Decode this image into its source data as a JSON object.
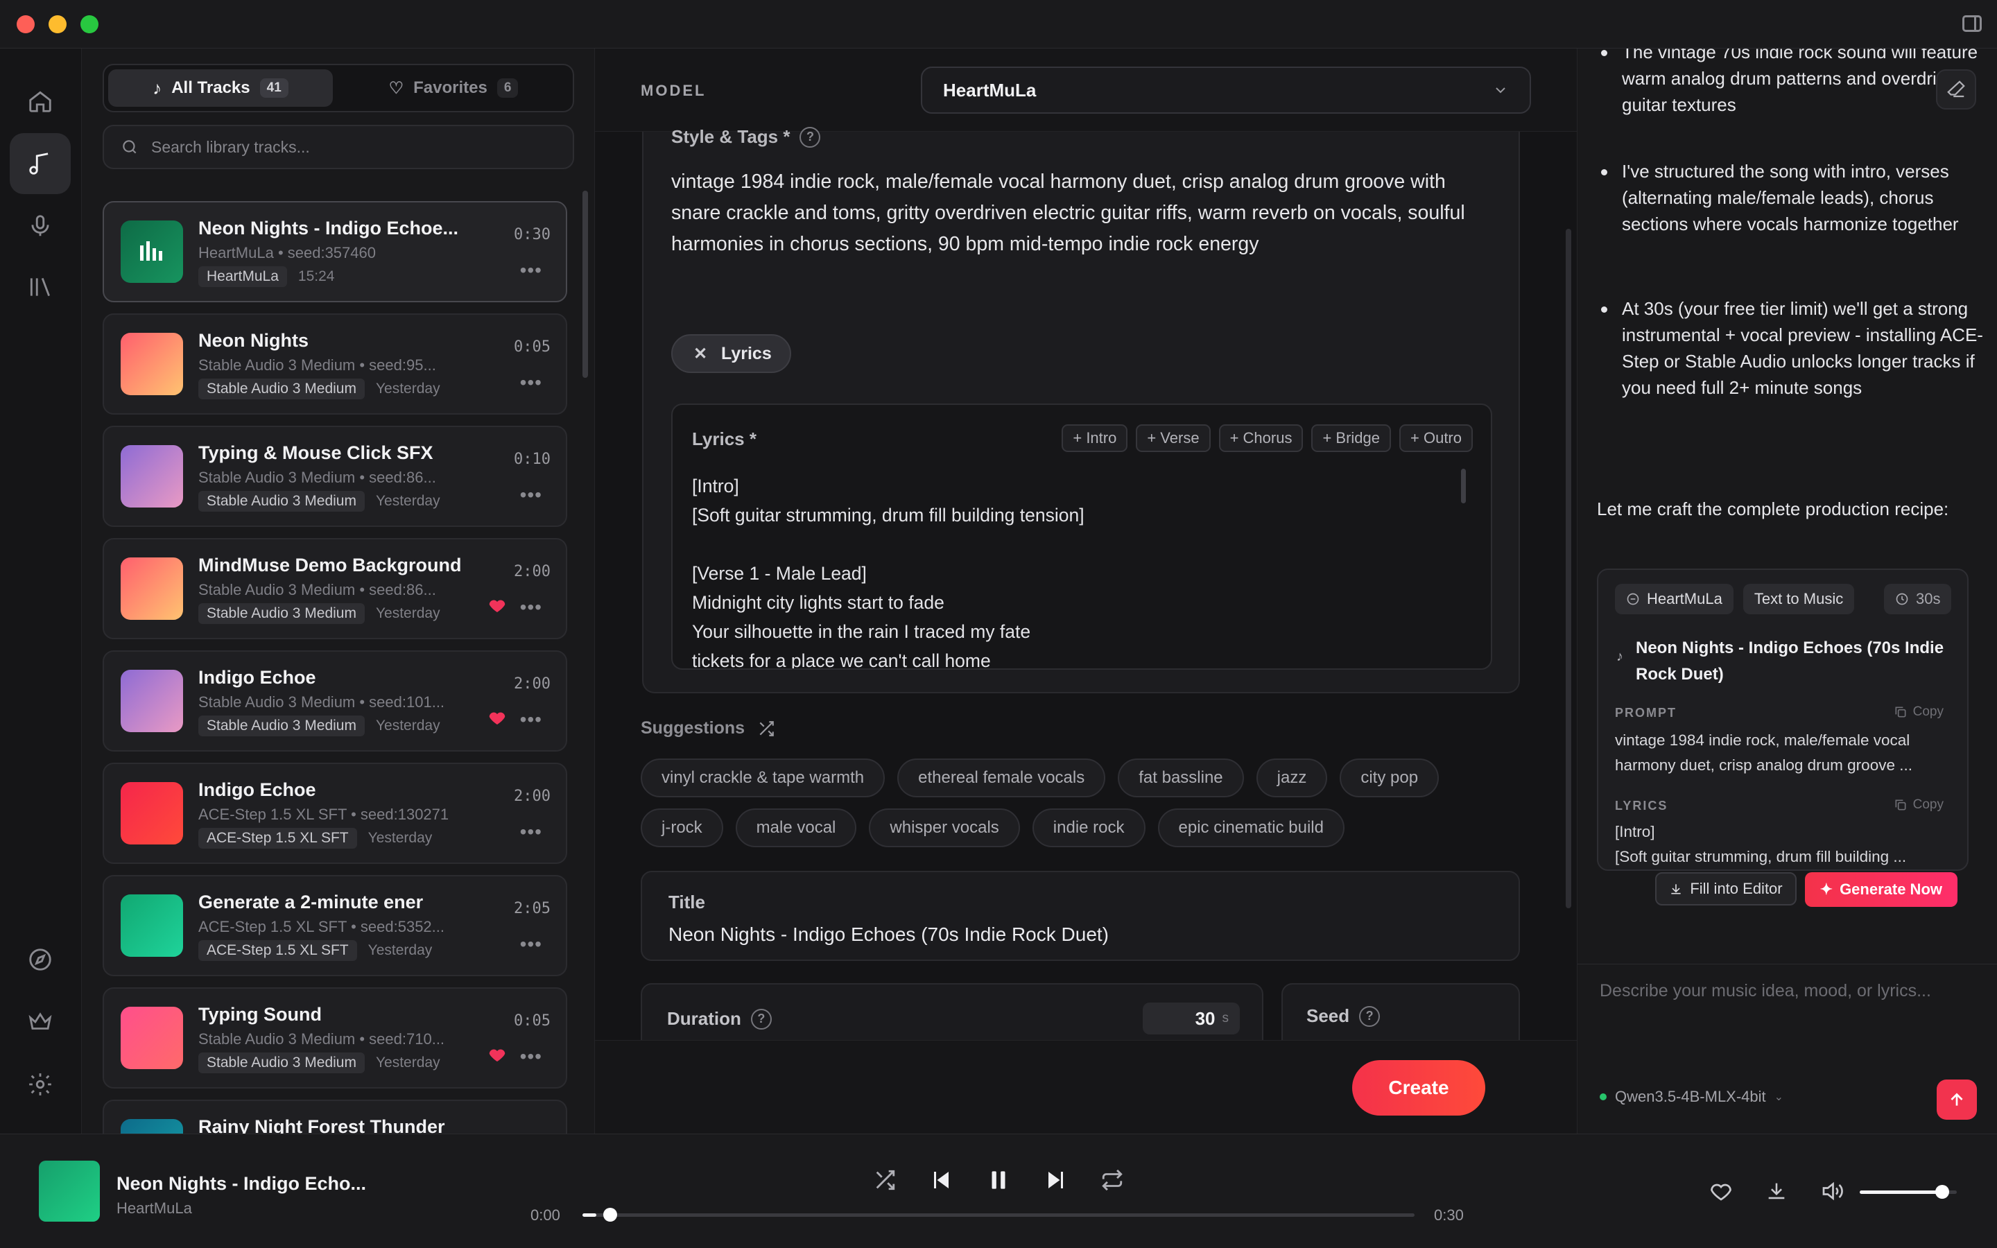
{
  "library": {
    "tabs": [
      {
        "label": "All Tracks",
        "count": "41"
      },
      {
        "label": "Favorites",
        "count": "6"
      }
    ],
    "search_placeholder": "Search library tracks...",
    "tracks": [
      {
        "title": "Neon Nights - Indigo Echoe...",
        "meta": "HeartMuLa • seed:357460",
        "tag": "HeartMuLa",
        "when": "15:24",
        "duration": "0:30",
        "favorite": false
      },
      {
        "title": "Neon Nights",
        "meta": "Stable Audio 3 Medium • seed:95...",
        "tag": "Stable Audio 3 Medium",
        "when": "Yesterday",
        "duration": "0:05",
        "favorite": false
      },
      {
        "title": "Typing & Mouse Click SFX",
        "meta": "Stable Audio 3 Medium • seed:86...",
        "tag": "Stable Audio 3 Medium",
        "when": "Yesterday",
        "duration": "0:10",
        "favorite": false
      },
      {
        "title": "MindMuse Demo Background",
        "meta": "Stable Audio 3 Medium • seed:86...",
        "tag": "Stable Audio 3 Medium",
        "when": "Yesterday",
        "duration": "2:00",
        "favorite": true
      },
      {
        "title": "Indigo Echoe",
        "meta": "Stable Audio 3 Medium • seed:101...",
        "tag": "Stable Audio 3 Medium",
        "when": "Yesterday",
        "duration": "2:00",
        "favorite": true
      },
      {
        "title": "Indigo Echoe",
        "meta": "ACE-Step 1.5 XL SFT • seed:130271",
        "tag": "ACE-Step 1.5 XL SFT",
        "when": "Yesterday",
        "duration": "2:00",
        "favorite": false
      },
      {
        "title": "Generate a 2-minute ener",
        "meta": "ACE-Step 1.5 XL SFT • seed:5352...",
        "tag": "ACE-Step 1.5 XL SFT",
        "when": "Yesterday",
        "duration": "2:05",
        "favorite": false
      },
      {
        "title": "Typing Sound",
        "meta": "Stable Audio 3 Medium • seed:710...",
        "tag": "Stable Audio 3 Medium",
        "when": "Yesterday",
        "duration": "0:05",
        "favorite": true
      },
      {
        "title": "Rainy Night Forest Thunder",
        "meta": "",
        "tag": "",
        "when": "",
        "duration": "",
        "favorite": false
      }
    ]
  },
  "editor": {
    "model_label": "MODEL",
    "model_value": "HeartMuLa",
    "style_label": "Style & Tags *",
    "style_text": "vintage 1984 indie rock, male/female vocal harmony duet, crisp analog drum groove with snare crackle and toms, gritty overdriven electric guitar riffs, warm reverb on vocals, soulful harmonies in chorus sections, 90 bpm mid-tempo indie rock energy",
    "lyrics_chip": "Lyrics",
    "lyrics_label": "Lyrics *",
    "section_buttons": [
      "+ Intro",
      "+ Verse",
      "+ Chorus",
      "+ Bridge",
      "+ Outro"
    ],
    "lyrics_text": "[Intro]\n[Soft guitar strumming, drum fill building tension]\n\n[Verse 1 - Male Lead]\nMidnight city lights start to fade\nYour silhouette in the rain I traced my fate\ntickets for a place we can't call home",
    "suggestions_label": "Suggestions",
    "suggestions_row1": [
      "vinyl crackle & tape warmth",
      "ethereal female vocals",
      "fat bassline",
      "jazz",
      "city pop"
    ],
    "suggestions_row2": [
      "j-rock",
      "male vocal",
      "whisper vocals",
      "indie rock",
      "epic cinematic build"
    ],
    "title_label": "Title",
    "title_value": "Neon Nights - Indigo Echoes (70s Indie Rock Duet)",
    "duration_label": "Duration",
    "duration_value": "30",
    "duration_unit": "s",
    "seed_label": "Seed",
    "create_label": "Create"
  },
  "chat": {
    "bullet_0": "The vintage 70s indie rock sound will feature warm analog drum patterns and overdriven guitar textures",
    "bullet_1": "I've structured the song with intro, verses (alternating male/female leads), chorus sections where vocals harmonize together",
    "bullet_2": "At 30s (your free tier limit) we'll get a strong instrumental + vocal preview - installing ACE-Step or Stable Audio unlocks longer tracks if you need full 2+ minute songs",
    "intro": "Let me craft the complete production recipe:",
    "recipe": {
      "model": "HeartMuLa",
      "mode": "Text to Music",
      "duration": "30s",
      "title": "Neon Nights - Indigo Echoes (70s Indie Rock Duet)",
      "prompt_label": "PROMPT",
      "prompt_text": "vintage 1984 indie rock, male/female vocal harmony duet, crisp analog drum groove ...",
      "lyrics_label": "LYRICS",
      "lyrics_text": "[Intro]\n[Soft guitar strumming, drum fill building ...",
      "copy_label": "Copy",
      "fill_label": "Fill into Editor",
      "generate_label": "Generate Now"
    },
    "input_placeholder": "Describe your music idea, mood, or lyrics...",
    "llm_model": "Qwen3.5-4B-MLX-4bit"
  },
  "player": {
    "title": "Neon Nights - Indigo Echo...",
    "artist": "HeartMuLa",
    "elapsed": "0:00",
    "total": "0:30",
    "progress": 0.017,
    "volume": 0.85
  },
  "colors": {
    "accent": "#f4324a",
    "favorite": "#f2335a"
  },
  "icons": {
    "rail": [
      "home-icon",
      "music-note-icon",
      "microphone-icon",
      "library-icon",
      "compass-icon",
      "crown-icon",
      "gear-icon"
    ]
  }
}
